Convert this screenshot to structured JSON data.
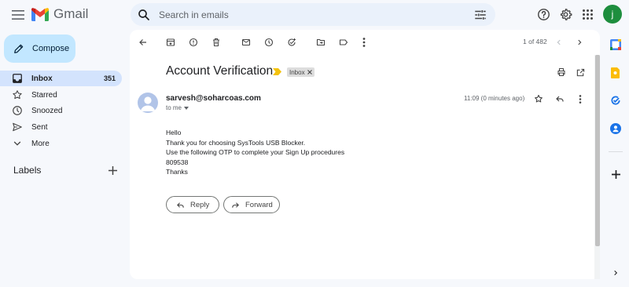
{
  "header": {
    "app_name": "Gmail",
    "search_placeholder": "Search in emails",
    "avatar_initial": "j"
  },
  "sidebar": {
    "compose_label": "Compose",
    "items": [
      {
        "label": "Inbox",
        "count": "351",
        "icon": "inbox-icon",
        "active": true
      },
      {
        "label": "Starred",
        "count": "",
        "icon": "star-icon",
        "active": false
      },
      {
        "label": "Snoozed",
        "count": "",
        "icon": "clock-icon",
        "active": false
      },
      {
        "label": "Sent",
        "count": "",
        "icon": "send-icon",
        "active": false
      },
      {
        "label": "More",
        "count": "",
        "icon": "chevron-down-icon",
        "active": false
      }
    ],
    "labels_title": "Labels"
  },
  "toolbar": {
    "page_count": "1 of 482"
  },
  "message": {
    "subject": "Account Verification",
    "label_chip": "Inbox",
    "sender_email": "sarvesh@soharcoas.com",
    "recipient": "to me",
    "time": "11:09 (0 minutes ago)",
    "body_lines": [
      "Hello",
      "Thank you for choosing SysTools USB Blocker.",
      "Use the following OTP to complete your Sign Up procedures",
      "809538",
      "Thanks"
    ],
    "reply_label": "Reply",
    "forward_label": "Forward"
  },
  "colors": {
    "background": "#f6f8fc",
    "compose": "#c2e7ff",
    "active_nav": "#d3e3fd",
    "search": "#eaf1fb",
    "avatar": "#1e8e3e"
  }
}
